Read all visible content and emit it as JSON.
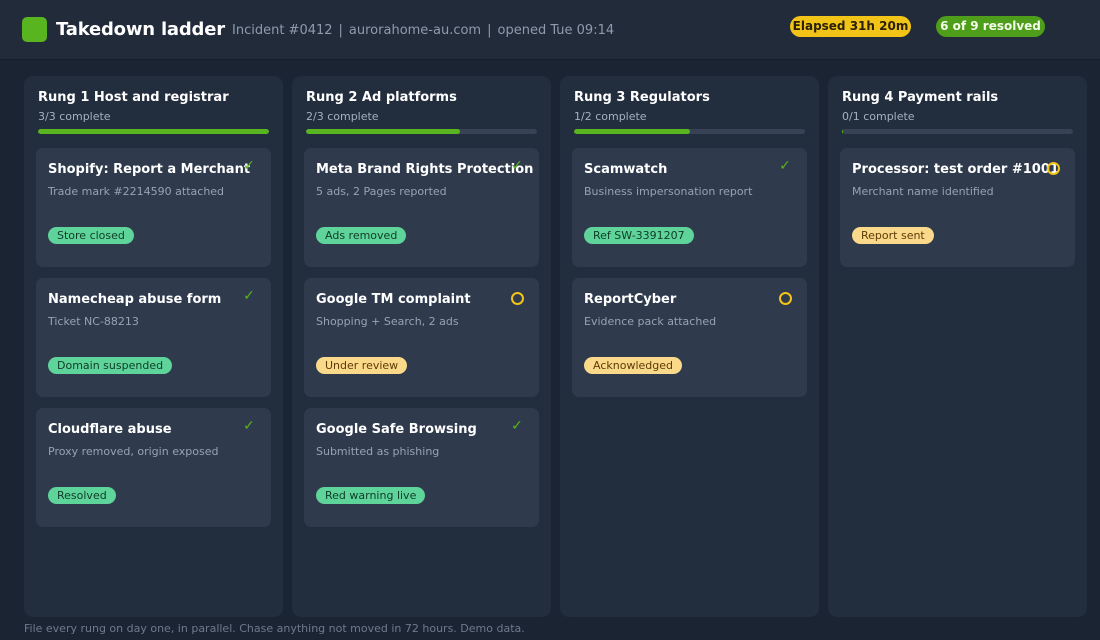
{
  "header": {
    "title": "Takedown ladder",
    "incident": "Incident #0412",
    "domain": "aurorahome-au.com",
    "opened": "opened Tue 09:14",
    "separator": "|",
    "elapsed": "Elapsed 31h 20m",
    "resolved": "6 of 9 resolved"
  },
  "colors": {
    "accent_green": "#58b41f",
    "accent_yellow": "#f2c418",
    "badge_green": "#5fd49a",
    "badge_yellow": "#fbd98b"
  },
  "columns": [
    {
      "title": "Rung 1  Host and registrar",
      "subtitle": "3/3 complete",
      "progress": 1.0,
      "cards": [
        {
          "title": "Shopify: Report a Merchant",
          "detail": "Trade mark #2214590 attached",
          "status": "done",
          "status_icon": "check-icon",
          "badge": "Store closed",
          "badge_tone": "green"
        },
        {
          "title": "Namecheap abuse form",
          "detail": "Ticket NC-88213",
          "status": "done",
          "status_icon": "check-icon",
          "badge": "Domain suspended",
          "badge_tone": "green"
        },
        {
          "title": "Cloudflare abuse",
          "detail": "Proxy removed, origin exposed",
          "status": "done",
          "status_icon": "check-icon",
          "badge": "Resolved",
          "badge_tone": "green"
        }
      ]
    },
    {
      "title": "Rung 2  Ad platforms",
      "subtitle": "2/3 complete",
      "progress": 0.667,
      "cards": [
        {
          "title": "Meta Brand Rights Protection",
          "detail": "5 ads, 2 Pages reported",
          "status": "done",
          "status_icon": "check-icon",
          "badge": "Ads removed",
          "badge_tone": "green"
        },
        {
          "title": "Google TM complaint",
          "detail": "Shopping + Search, 2 ads",
          "status": "pending",
          "status_icon": "pending-circle-icon",
          "badge": "Under review",
          "badge_tone": "yellow"
        },
        {
          "title": "Google Safe Browsing",
          "detail": "Submitted as phishing",
          "status": "done",
          "status_icon": "check-icon",
          "badge": "Red warning live",
          "badge_tone": "green"
        }
      ]
    },
    {
      "title": "Rung 3  Regulators",
      "subtitle": "1/2 complete",
      "progress": 0.5,
      "cards": [
        {
          "title": "Scamwatch",
          "detail": "Business impersonation report",
          "status": "done",
          "status_icon": "check-icon",
          "badge": "Ref SW-3391207",
          "badge_tone": "green"
        },
        {
          "title": "ReportCyber",
          "detail": "Evidence pack attached",
          "status": "pending",
          "status_icon": "pending-circle-icon",
          "badge": "Acknowledged",
          "badge_tone": "yellow"
        }
      ]
    },
    {
      "title": "Rung 4  Payment rails",
      "subtitle": "0/1 complete",
      "progress": 0.0,
      "cards": [
        {
          "title": "Processor: test order #1001",
          "detail": "Merchant name identified",
          "status": "pending",
          "status_icon": "pending-circle-icon",
          "badge": "Report sent",
          "badge_tone": "yellow"
        }
      ]
    }
  ],
  "footer": "File every rung on day one, in parallel. Chase anything not moved in 72 hours. Demo data."
}
